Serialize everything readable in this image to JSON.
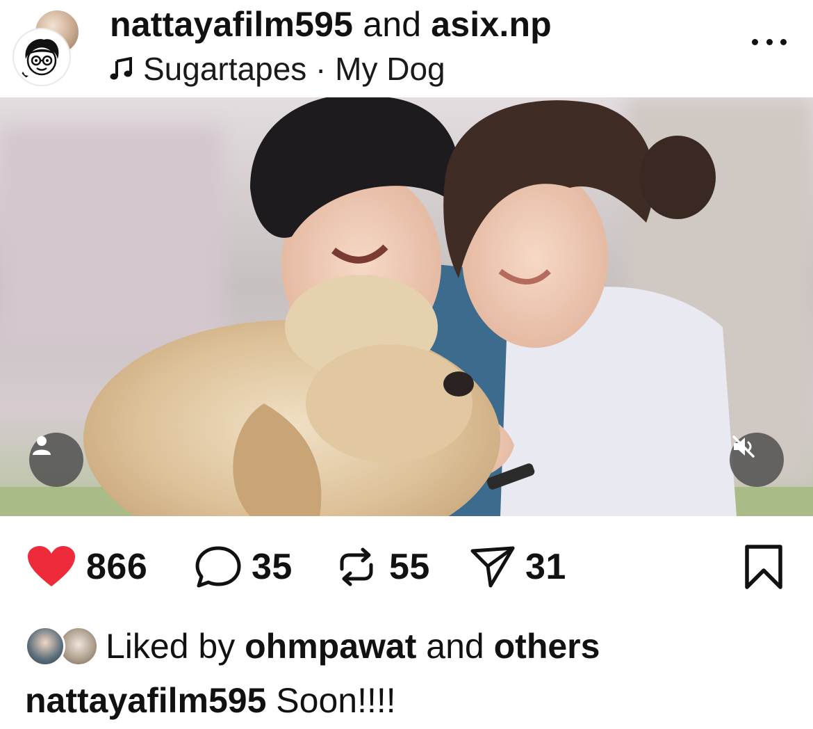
{
  "post": {
    "author": "nattayafilm595",
    "connector": "and",
    "collaborator": "asix.np",
    "music": "Sugartapes · My Dog",
    "music_icon": "music-note-icon",
    "more_icon": "more-options-icon"
  },
  "media": {
    "user_tag_icon": "user-tag-icon",
    "mute_icon": "speaker-muted-icon"
  },
  "actions": {
    "likes": "866",
    "comments": "35",
    "reposts": "55",
    "shares": "31",
    "like_color": "#ee2b3b"
  },
  "liked_by": {
    "prefix": "Liked by",
    "user": "ohmpawat",
    "connector": "and",
    "others": "others"
  },
  "caption": {
    "author": "nattayafilm595",
    "text": "Soon!!!!"
  }
}
